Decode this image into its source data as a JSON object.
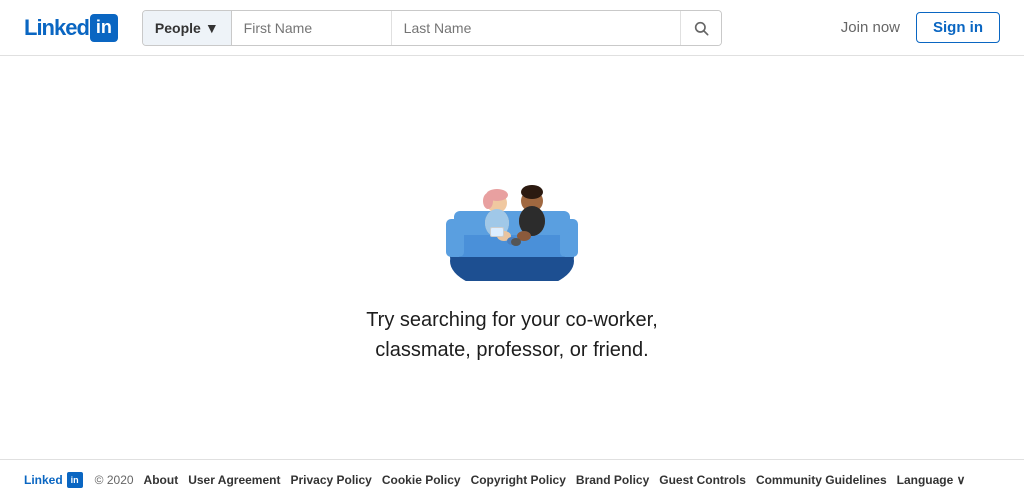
{
  "header": {
    "logo_text": "Linked",
    "logo_box": "in",
    "search": {
      "type_label": "People",
      "first_name_placeholder": "First Name",
      "last_name_placeholder": "Last Name"
    },
    "join_now_label": "Join now",
    "sign_in_label": "Sign in"
  },
  "main": {
    "prompt_line1": "Try searching for your co-worker,",
    "prompt_line2": "classmate, professor, or friend."
  },
  "footer": {
    "logo_text": "Linked",
    "logo_box": "in",
    "copyright": "© 2020",
    "links": [
      {
        "label": "About"
      },
      {
        "label": "User Agreement"
      },
      {
        "label": "Privacy Policy"
      },
      {
        "label": "Cookie Policy"
      },
      {
        "label": "Copyright Policy"
      },
      {
        "label": "Brand Policy"
      },
      {
        "label": "Guest Controls"
      },
      {
        "label": "Community Guidelines"
      },
      {
        "label": "Language ∨"
      }
    ]
  }
}
